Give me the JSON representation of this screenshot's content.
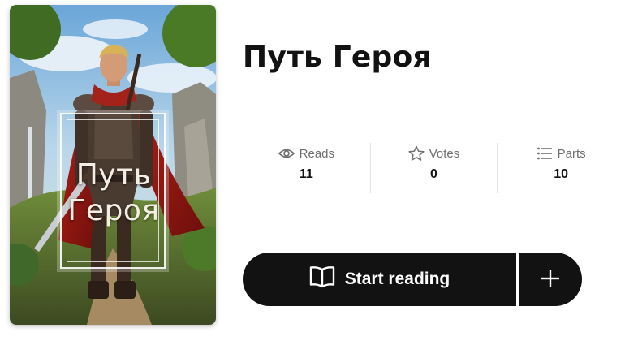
{
  "story": {
    "title": "Путь Героя",
    "cover_title_line1": "Путь",
    "cover_title_line2": "Героя"
  },
  "stats": [
    {
      "icon": "eye-icon",
      "label": "Reads",
      "value": "11"
    },
    {
      "icon": "star-icon",
      "label": "Votes",
      "value": "0"
    },
    {
      "icon": "list-icon",
      "label": "Parts",
      "value": "10"
    }
  ],
  "actions": {
    "start_reading_label": "Start reading",
    "start_reading_icon": "book-open-icon",
    "add_icon": "plus-icon"
  },
  "colors": {
    "button_bg": "#121212",
    "button_text": "#ffffff",
    "stat_label": "#6f6f6f"
  }
}
